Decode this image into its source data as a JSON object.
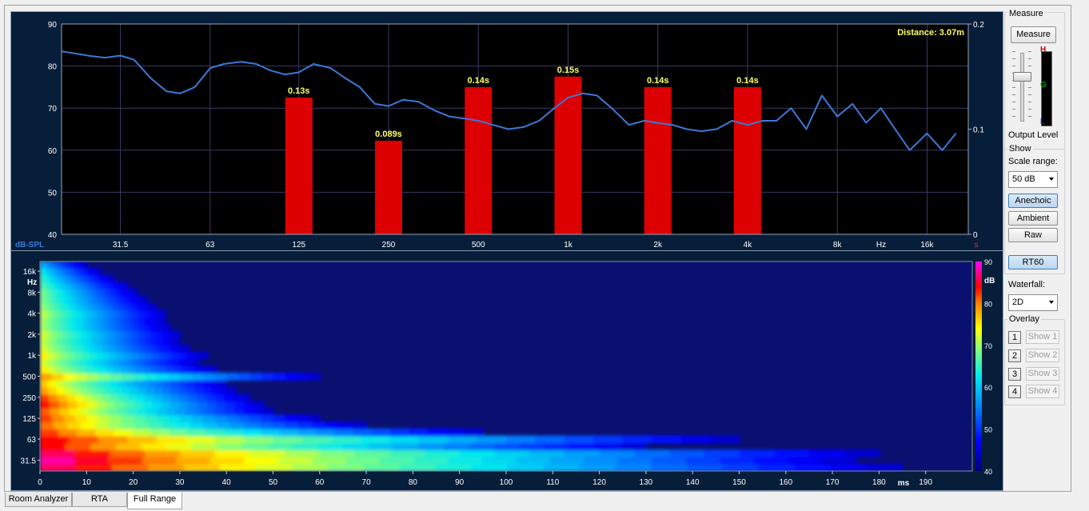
{
  "tabs": [
    {
      "label": "Room Analyzer",
      "active": false
    },
    {
      "label": "RTA",
      "active": false
    },
    {
      "label": "Full Range",
      "active": true
    }
  ],
  "sidebar": {
    "measure_group_title": "Measure",
    "measure_button": "Measure",
    "meter_labels": {
      "high": "H",
      "good": "G",
      "low": "L"
    },
    "output_level_label": "Output Level",
    "show_group_title": "Show",
    "scale_range_label": "Scale range:",
    "scale_range_value": "50 dB",
    "anechoic_button": "Anechoic",
    "ambient_button": "Ambient",
    "raw_button": "Raw",
    "rt60_button": "RT60",
    "waterfall_label": "Waterfall:",
    "waterfall_value": "2D",
    "overlay_group_title": "Overlay",
    "overlay_items": [
      {
        "num": "1",
        "label": "Show 1"
      },
      {
        "num": "2",
        "label": "Show 2"
      },
      {
        "num": "3",
        "label": "Show 3"
      },
      {
        "num": "4",
        "label": "Show 4"
      }
    ]
  },
  "colors": {
    "panel_bg": "#061e3a",
    "plot_bg": "#000000",
    "curve": "#3c78d8",
    "bar": "#dd0000",
    "bar_label": "#ffff66",
    "axis_text": "#ffffff",
    "axis_title": "#3a7bd5",
    "distance_text": "#ffff66",
    "rt_axis_unit": "#dd3333"
  },
  "chart_data": [
    {
      "type": "line",
      "distance_label": "Distance: 3.07m",
      "ylabel": "dB-SPL",
      "xlabel": "Hz",
      "y2label": "s",
      "ylim": [
        40,
        90
      ],
      "y_ticks": [
        40,
        50,
        60,
        70,
        80,
        90
      ],
      "y2lim": [
        0,
        0.2
      ],
      "y2_ticks": [
        "0",
        "0.1",
        "0.2"
      ],
      "xlim": [
        20,
        22000
      ],
      "x_scale": "log",
      "x_ticks": [
        {
          "v": 31.5,
          "label": "31.5"
        },
        {
          "v": 63,
          "label": "63"
        },
        {
          "v": 125,
          "label": "125"
        },
        {
          "v": 250,
          "label": "250"
        },
        {
          "v": 500,
          "label": "500"
        },
        {
          "v": 1000,
          "label": "1k"
        },
        {
          "v": 2000,
          "label": "2k"
        },
        {
          "v": 4000,
          "label": "4k"
        },
        {
          "v": 8000,
          "label": "8k"
        },
        {
          "v": 16000,
          "label": "16k"
        }
      ],
      "grid": true,
      "series": [
        {
          "x": [
            20,
            25,
            28,
            31.5,
            35,
            40,
            45,
            50,
            56,
            63,
            70,
            80,
            90,
            100,
            112,
            125,
            140,
            160,
            180,
            200,
            225,
            250,
            280,
            315,
            355,
            400,
            450,
            500,
            560,
            630,
            710,
            800,
            900,
            1000,
            1120,
            1250,
            1400,
            1600,
            1800,
            2000,
            2240,
            2500,
            2800,
            3150,
            3550,
            4000,
            4500,
            5000,
            5600,
            6300,
            7100,
            8000,
            9000,
            10000,
            11200,
            12500,
            14000,
            16000,
            18000,
            20000
          ],
          "y": [
            83.5,
            82.4,
            82,
            82.5,
            81.5,
            77,
            74,
            73.5,
            75,
            79.5,
            80.5,
            81,
            80.5,
            79,
            78,
            78.5,
            80.5,
            79.5,
            77,
            75,
            71,
            70.5,
            72,
            71.5,
            69.5,
            68,
            67.5,
            67,
            66,
            65,
            65.5,
            67,
            70,
            72.5,
            73.5,
            73,
            70,
            66,
            67,
            66.5,
            66,
            65,
            64.5,
            65,
            67,
            66,
            67,
            67,
            70,
            65,
            73,
            68,
            71,
            66.5,
            70,
            65,
            60,
            64,
            60,
            64
          ]
        }
      ],
      "rt60_bars": [
        {
          "x": 125,
          "value": 0.13,
          "label": "0.13s"
        },
        {
          "x": 250,
          "value": 0.089,
          "label": "0.089s"
        },
        {
          "x": 500,
          "value": 0.14,
          "label": "0.14s"
        },
        {
          "x": 1000,
          "value": 0.15,
          "label": "0.15s"
        },
        {
          "x": 2000,
          "value": 0.14,
          "label": "0.14s"
        },
        {
          "x": 4000,
          "value": 0.14,
          "label": "0.14s"
        }
      ]
    },
    {
      "type": "heatmap",
      "xlabel": "ms",
      "ylabel": "Hz",
      "colorbar_label": "dB",
      "xlim": [
        0,
        200
      ],
      "x_ticks": [
        0,
        10,
        20,
        30,
        40,
        50,
        60,
        70,
        80,
        90,
        100,
        110,
        120,
        130,
        140,
        150,
        160,
        170,
        180,
        190
      ],
      "y_scale": "log",
      "y_ticks": [
        {
          "v": 31.5,
          "label": "31.5"
        },
        {
          "v": 63,
          "label": "63"
        },
        {
          "v": 125,
          "label": "125"
        },
        {
          "v": 250,
          "label": "250"
        },
        {
          "v": 500,
          "label": "500"
        },
        {
          "v": 1000,
          "label": "1k"
        },
        {
          "v": 2000,
          "label": "2k"
        },
        {
          "v": 4000,
          "label": "4k"
        },
        {
          "v": 8000,
          "label": "8k"
        },
        {
          "v": 16000,
          "label": "16k"
        }
      ],
      "colorbar_range": [
        40,
        90
      ],
      "colorbar_ticks": [
        40,
        50,
        60,
        70,
        80,
        90
      ],
      "decay_bands": [
        {
          "f": 25,
          "level": 88,
          "decay_ms": 185
        },
        {
          "f": 31.5,
          "level": 90,
          "decay_ms": 175
        },
        {
          "f": 40,
          "level": 88,
          "decay_ms": 180
        },
        {
          "f": 50,
          "level": 86,
          "decay_ms": 130
        },
        {
          "f": 63,
          "level": 86,
          "decay_ms": 150
        },
        {
          "f": 80,
          "level": 84,
          "decay_ms": 95
        },
        {
          "f": 100,
          "level": 82,
          "decay_ms": 70
        },
        {
          "f": 125,
          "level": 84,
          "decay_ms": 60
        },
        {
          "f": 160,
          "level": 83,
          "decay_ms": 50
        },
        {
          "f": 200,
          "level": 86,
          "decay_ms": 48
        },
        {
          "f": 250,
          "level": 84,
          "decay_ms": 45
        },
        {
          "f": 315,
          "level": 80,
          "decay_ms": 42
        },
        {
          "f": 400,
          "level": 78,
          "decay_ms": 40
        },
        {
          "f": 500,
          "level": 80,
          "decay_ms": 60
        },
        {
          "f": 630,
          "level": 76,
          "decay_ms": 38
        },
        {
          "f": 800,
          "level": 74,
          "decay_ms": 34
        },
        {
          "f": 1000,
          "level": 76,
          "decay_ms": 36
        },
        {
          "f": 1250,
          "level": 74,
          "decay_ms": 32
        },
        {
          "f": 1600,
          "level": 73,
          "decay_ms": 30
        },
        {
          "f": 2000,
          "level": 74,
          "decay_ms": 30
        },
        {
          "f": 2500,
          "level": 72,
          "decay_ms": 28
        },
        {
          "f": 3150,
          "level": 72,
          "decay_ms": 27
        },
        {
          "f": 4000,
          "level": 73,
          "decay_ms": 27
        },
        {
          "f": 5000,
          "level": 71,
          "decay_ms": 25
        },
        {
          "f": 6300,
          "level": 70,
          "decay_ms": 23
        },
        {
          "f": 8000,
          "level": 70,
          "decay_ms": 21
        },
        {
          "f": 10000,
          "level": 68,
          "decay_ms": 19
        },
        {
          "f": 12500,
          "level": 66,
          "decay_ms": 16
        },
        {
          "f": 16000,
          "level": 64,
          "decay_ms": 13
        },
        {
          "f": 20000,
          "level": 60,
          "decay_ms": 10
        }
      ]
    }
  ]
}
